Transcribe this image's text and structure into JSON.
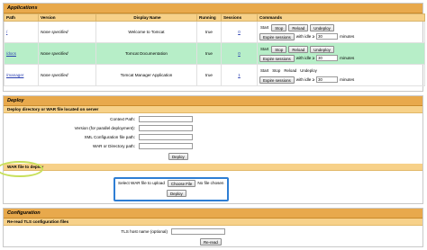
{
  "applications": {
    "title": "Applications",
    "columns": [
      "Path",
      "Version",
      "Display Name",
      "Running",
      "Sessions",
      "Commands"
    ],
    "rows": [
      {
        "path": "/",
        "version": "None specified",
        "display_name": "Welcome to Tomcat",
        "running": "true",
        "sessions": "0",
        "highlight": false,
        "commands": "buttons"
      },
      {
        "path": "/docs",
        "version": "None specified",
        "display_name": "Tomcat Documentation",
        "running": "true",
        "sessions": "0",
        "highlight": true,
        "commands": "buttons"
      },
      {
        "path": "/manager",
        "version": "None specified",
        "display_name": "Tomcat Manager Application",
        "running": "true",
        "sessions": "1",
        "highlight": false,
        "commands": "text"
      }
    ],
    "commands": {
      "start": "Start",
      "stop": "Stop",
      "reload": "Reload",
      "undeploy": "Undeploy",
      "expire": "Expire sessions",
      "with_idle": "with idle ≥",
      "idle_value": "30",
      "minutes": "minutes"
    }
  },
  "deploy": {
    "title": "Deploy",
    "subtitle": "Deploy directory or WAR file located on server",
    "fields": [
      {
        "label": "Context Path:"
      },
      {
        "label": "Version (for parallel deployment):"
      },
      {
        "label": "XML Configuration file path:"
      },
      {
        "label": "WAR or Directory path:"
      }
    ],
    "deploy_button": "Deploy",
    "war_title": "WAR file to deploy",
    "upload_label": "Select WAR file to upload",
    "choose_file": "Choose File",
    "no_file": "No file chosen",
    "upload_deploy_button": "Deploy",
    "highlight_color": "#2e7ed4",
    "oval_color": "#c7e05a"
  },
  "configuration": {
    "title": "Configuration",
    "subtitle": "Re-read TLS configuration files",
    "tls_label": "TLS host name (optional)",
    "reread_button": "Re-read"
  },
  "colors": {
    "section_header": "#e8a94c",
    "sub_header": "#f7d189",
    "row_highlight": "#b7eec8",
    "link": "#2a3fb0"
  }
}
